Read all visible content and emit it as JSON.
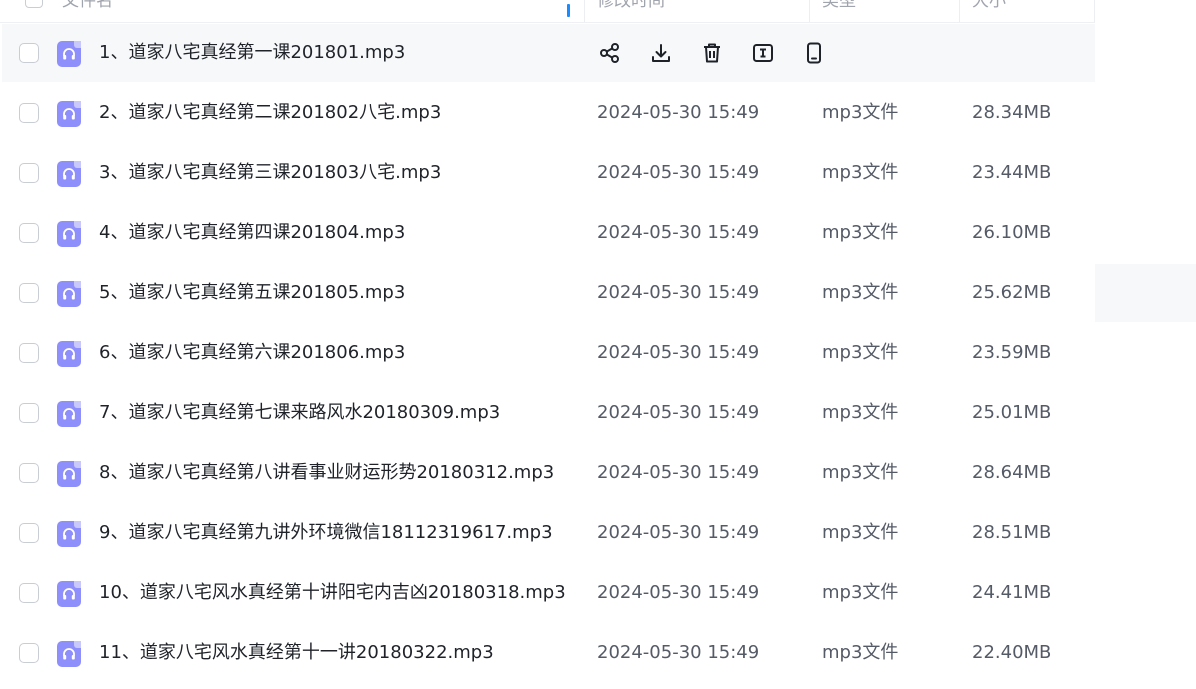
{
  "header": {
    "name_label": "文件名",
    "modified_label": "修改时间",
    "type_label": "类型",
    "size_label": "大小"
  },
  "file_icon": "audio-file-icon",
  "row_actions": [
    "share-icon",
    "download-icon",
    "delete-icon",
    "rename-icon",
    "phone-icon"
  ],
  "files": [
    {
      "name": "1、道家八宅真经第一课201801.mp3",
      "modified": "",
      "type": "",
      "size": ""
    },
    {
      "name": "2、道家八宅真经第二课201802八宅.mp3",
      "modified": "2024-05-30 15:49",
      "type": "mp3文件",
      "size": "28.34MB"
    },
    {
      "name": "3、道家八宅真经第三课201803八宅.mp3",
      "modified": "2024-05-30 15:49",
      "type": "mp3文件",
      "size": "23.44MB"
    },
    {
      "name": "4、道家八宅真经第四课201804.mp3",
      "modified": "2024-05-30 15:49",
      "type": "mp3文件",
      "size": "26.10MB"
    },
    {
      "name": "5、道家八宅真经第五课201805.mp3",
      "modified": "2024-05-30 15:49",
      "type": "mp3文件",
      "size": "25.62MB"
    },
    {
      "name": "6、道家八宅真经第六课201806.mp3",
      "modified": "2024-05-30 15:49",
      "type": "mp3文件",
      "size": "23.59MB"
    },
    {
      "name": "7、道家八宅真经第七课来路风水20180309.mp3",
      "modified": "2024-05-30 15:49",
      "type": "mp3文件",
      "size": "25.01MB"
    },
    {
      "name": "8、道家八宅真经第八讲看事业财运形势20180312.mp3",
      "modified": "2024-05-30 15:49",
      "type": "mp3文件",
      "size": "28.64MB"
    },
    {
      "name": "9、道家八宅真经第九讲外环境微信18112319617.mp3",
      "modified": "2024-05-30 15:49",
      "type": "mp3文件",
      "size": "28.51MB"
    },
    {
      "name": "10、道家八宅风水真经第十讲阳宅内吉凶20180318.mp3",
      "modified": "2024-05-30 15:49",
      "type": "mp3文件",
      "size": "24.41MB"
    },
    {
      "name": "11、道家八宅风水真经第十一讲20180322.mp3",
      "modified": "2024-05-30 15:49",
      "type": "mp3文件",
      "size": "22.40MB"
    }
  ]
}
